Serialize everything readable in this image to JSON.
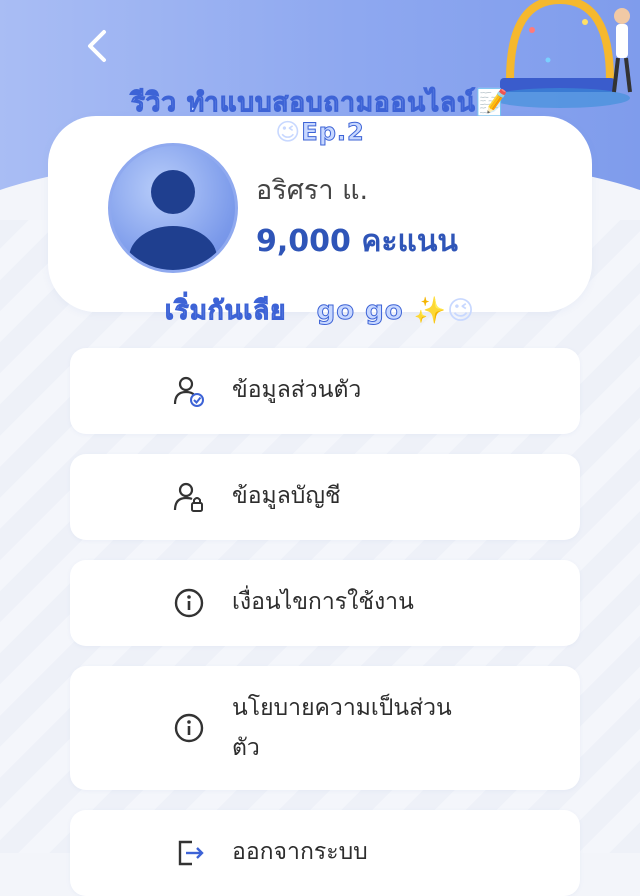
{
  "banner": {
    "line1": "รีวิว ทำแบบสอบถามออนไลน์",
    "line1_emoji": "📝",
    "line2": "Ep.2",
    "line2_emoji": "😉",
    "line3_a": "เริ่มกันเลีย",
    "line3_b": "go go",
    "line3_emoji": "✨😉"
  },
  "profile": {
    "name": "อริศรา แ.",
    "points": "9,000 คะแนน"
  },
  "menu": [
    {
      "label": "ข้อมูลส่วนตัว",
      "icon": "user-check-icon"
    },
    {
      "label": "ข้อมูลบัญชี",
      "icon": "user-lock-icon"
    },
    {
      "label": "เงื่อนไขการใช้งาน",
      "icon": "info-icon"
    },
    {
      "label": "นโยบายความเป็นส่วน",
      "label2": "ตัว",
      "icon": "info-icon"
    },
    {
      "label": "ออกจากระบบ",
      "icon": "logout-icon"
    }
  ],
  "colors": {
    "accent": "#2f55b8",
    "header": "#8ea8f0",
    "background": "#f3f5fa"
  }
}
